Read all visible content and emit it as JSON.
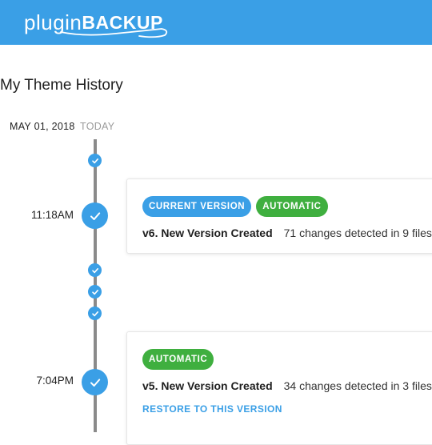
{
  "header": {
    "logo_plugin": "plugin",
    "logo_backup": "BACKUP",
    "color": "#3a9fe6"
  },
  "page_title": "My Theme History",
  "timeline": {
    "date": "MAY 01, 2018",
    "today_label": "TODAY",
    "entries": [
      {
        "time": "11:18AM",
        "badges": [
          "CURRENT VERSION",
          "AUTOMATIC"
        ],
        "title": "v6. New Version Created",
        "changes": "71 changes detected in 9 files"
      },
      {
        "time": "7:04PM",
        "badges": [
          "AUTOMATIC"
        ],
        "title": "v5. New Version Created",
        "changes": "34 changes detected in 3 files",
        "action": "RESTORE TO THIS VERSION"
      }
    ]
  },
  "colors": {
    "accent": "#3a9fe6",
    "automatic_badge": "#3faf3f",
    "timeline_line": "#8a8a8a"
  },
  "icons": {
    "timeline_dot": "check-circle-icon"
  }
}
